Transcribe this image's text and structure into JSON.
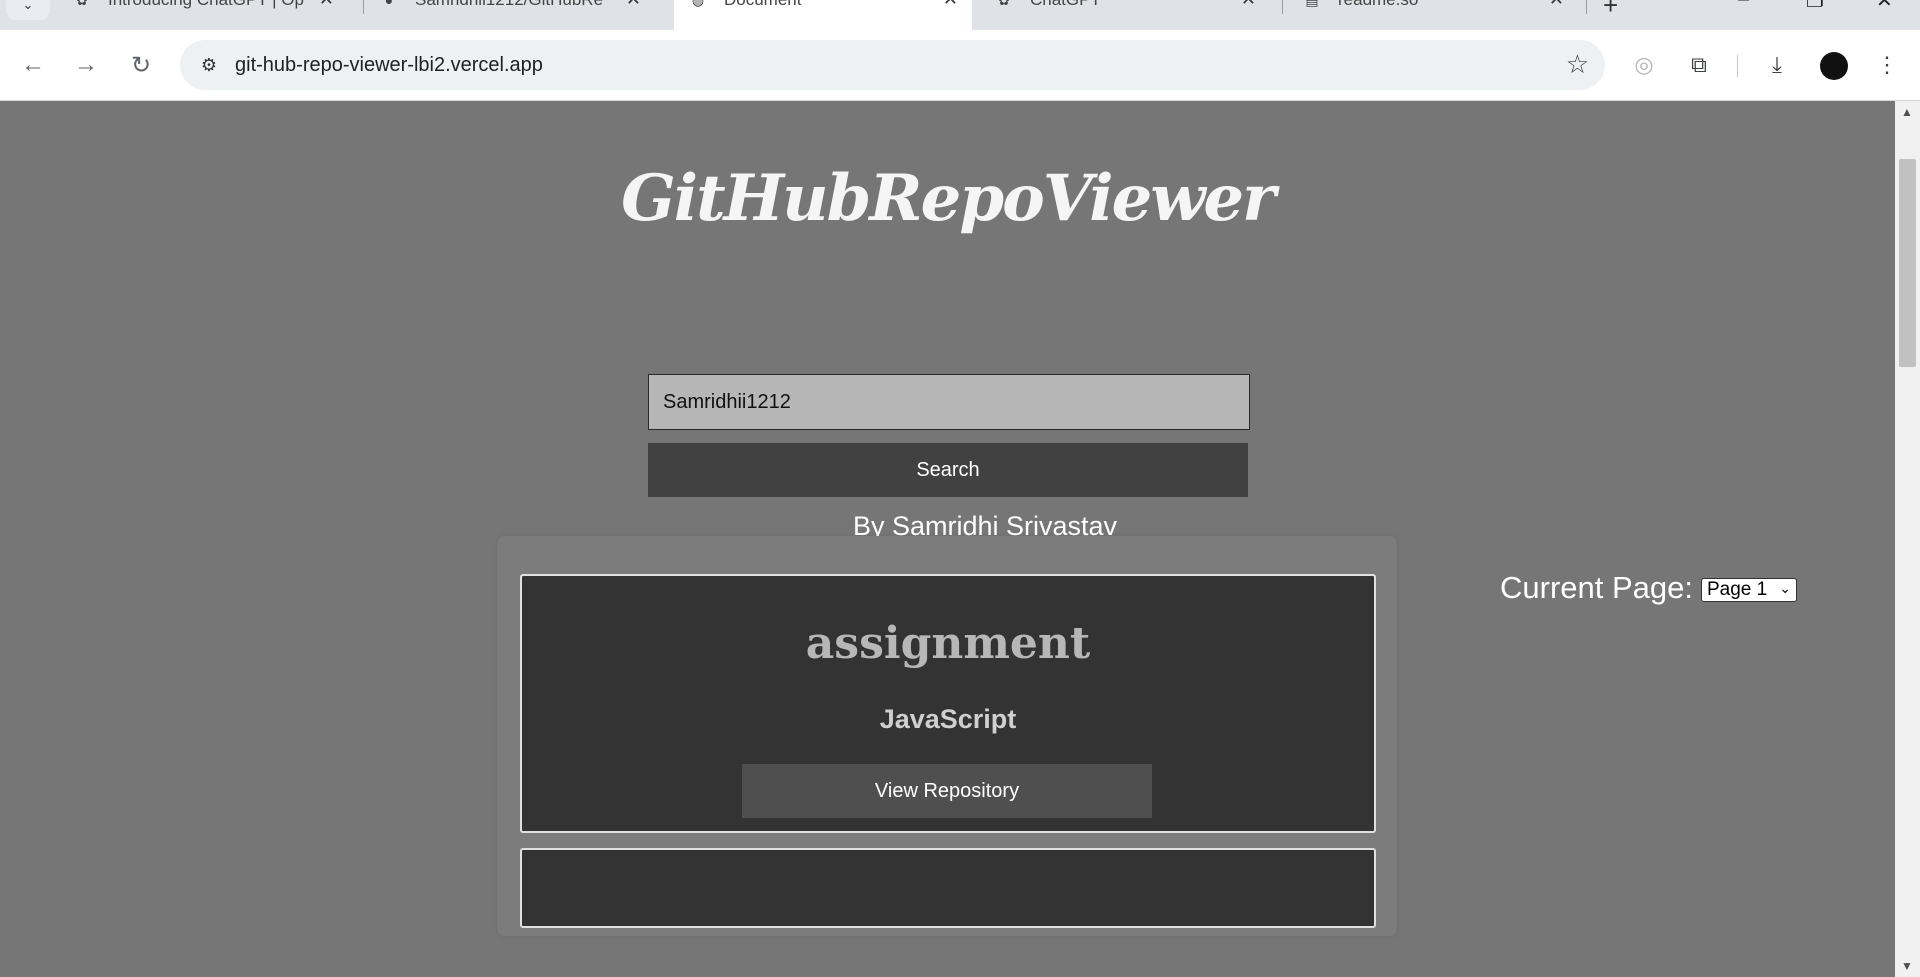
{
  "browser": {
    "tabs": [
      {
        "title": "Introducing ChatGPT | Op",
        "icon": "openai-icon",
        "active": false
      },
      {
        "title": "Samridhii1212/GitHubRe",
        "icon": "github-icon",
        "active": false
      },
      {
        "title": "Document",
        "icon": "globe-icon",
        "active": true
      },
      {
        "title": "ChatGPT",
        "icon": "openai-icon",
        "active": false
      },
      {
        "title": "readme.so",
        "icon": "readme-icon",
        "active": false
      }
    ],
    "url": "git-hub-repo-viewer-lbi2.vercel.app"
  },
  "page": {
    "title": "GitHubRepoViewer",
    "search": {
      "value": "Samridhii1212",
      "button_label": "Search"
    },
    "byline": "By Samridhi Srivastav",
    "pagination": {
      "label": "Current Page:",
      "selected": "Page 1"
    },
    "repos": [
      {
        "name": "assignment",
        "language": "JavaScript",
        "button_label": "View Repository"
      }
    ]
  },
  "colors": {
    "page_bg": "#767676",
    "card_bg": "#333333",
    "button_bg": "#414141",
    "input_bg": "#b6b6b6"
  }
}
